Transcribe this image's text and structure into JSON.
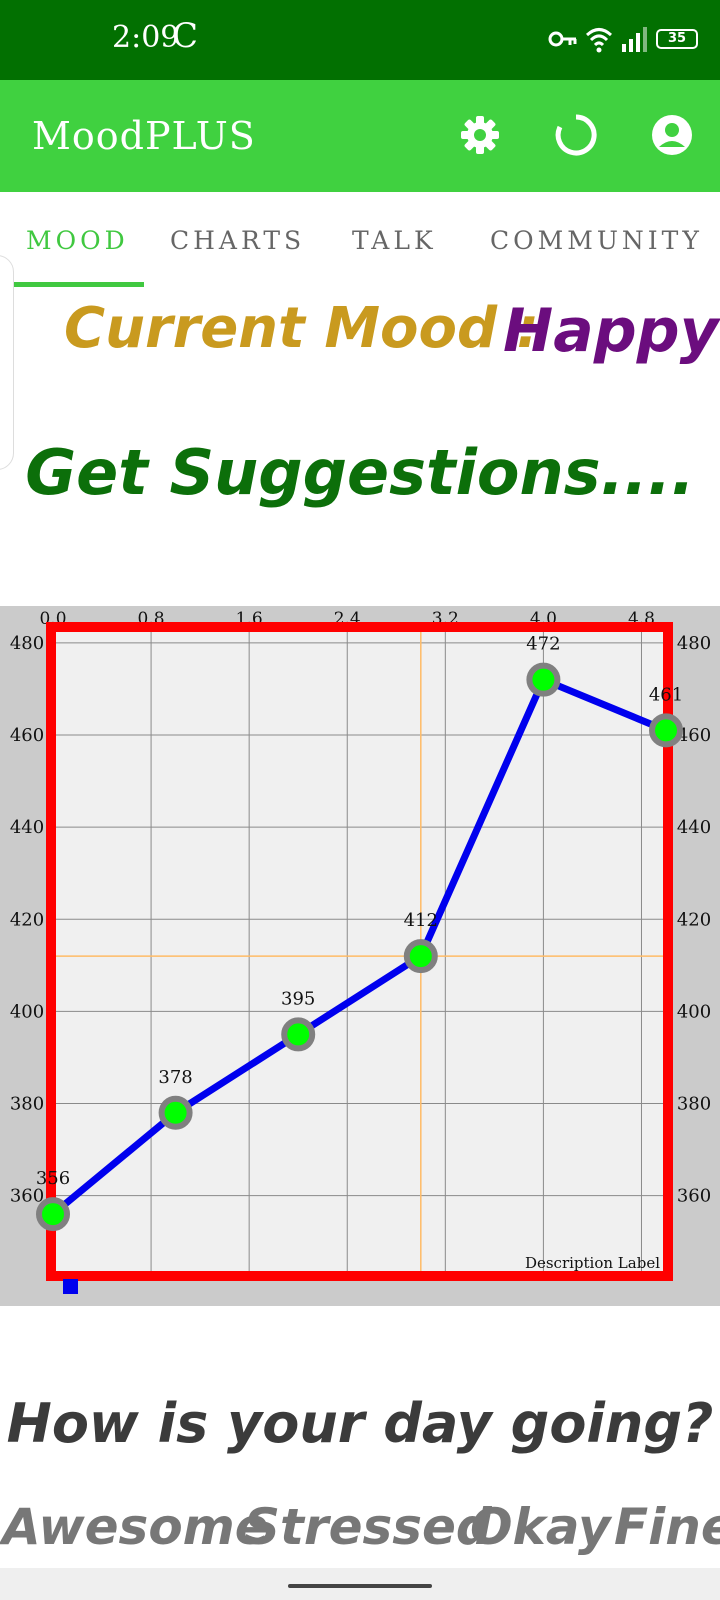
{
  "status_bar": {
    "time": "2:09",
    "time_icon": "C",
    "battery": "35",
    "icons": [
      "vpn-key-icon",
      "wifi-icon",
      "signal-icon",
      "battery-icon"
    ]
  },
  "app_bar": {
    "title": "MoodPLUS",
    "actions": [
      "settings-icon",
      "refresh-icon",
      "account-icon"
    ]
  },
  "tabs": [
    {
      "label": "MOOD",
      "active": true
    },
    {
      "label": "CHARTS",
      "active": false
    },
    {
      "label": "TALK",
      "active": false
    },
    {
      "label": "COMMUNITY",
      "active": false
    }
  ],
  "mood": {
    "label": "Current Mood :",
    "value": "Happy",
    "suggestions": "Get Suggestions...."
  },
  "chart_data": {
    "type": "line",
    "x": [
      0,
      1,
      2,
      3,
      4,
      5
    ],
    "values": [
      356,
      378,
      395,
      412,
      472,
      461
    ],
    "point_labels": [
      "356",
      "378",
      "395",
      "412",
      "472",
      "461"
    ],
    "x_ticks": [
      "0.0",
      "0.8",
      "1.6",
      "2.4",
      "3.2",
      "4.0",
      "4.8"
    ],
    "y_ticks_left": [
      "480",
      "460",
      "440",
      "420",
      "400",
      "380",
      "360"
    ],
    "y_ticks_right": [
      "480",
      "460",
      "440",
      "420",
      "400",
      "380",
      "360"
    ],
    "xlim": [
      0,
      5
    ],
    "ylim": [
      343,
      483
    ],
    "description": "Description Label",
    "grid": true,
    "line_color": "#0000ee",
    "point_color": "#00ff00",
    "point_stroke": "#808080",
    "border_color": "#ff0000",
    "highlight": {
      "x": 3,
      "y": 412,
      "color": "#ffbb66"
    }
  },
  "question": {
    "text": "How is your day going?",
    "options": [
      "Awesome",
      "Stressed",
      "Okay",
      "Fine"
    ]
  }
}
